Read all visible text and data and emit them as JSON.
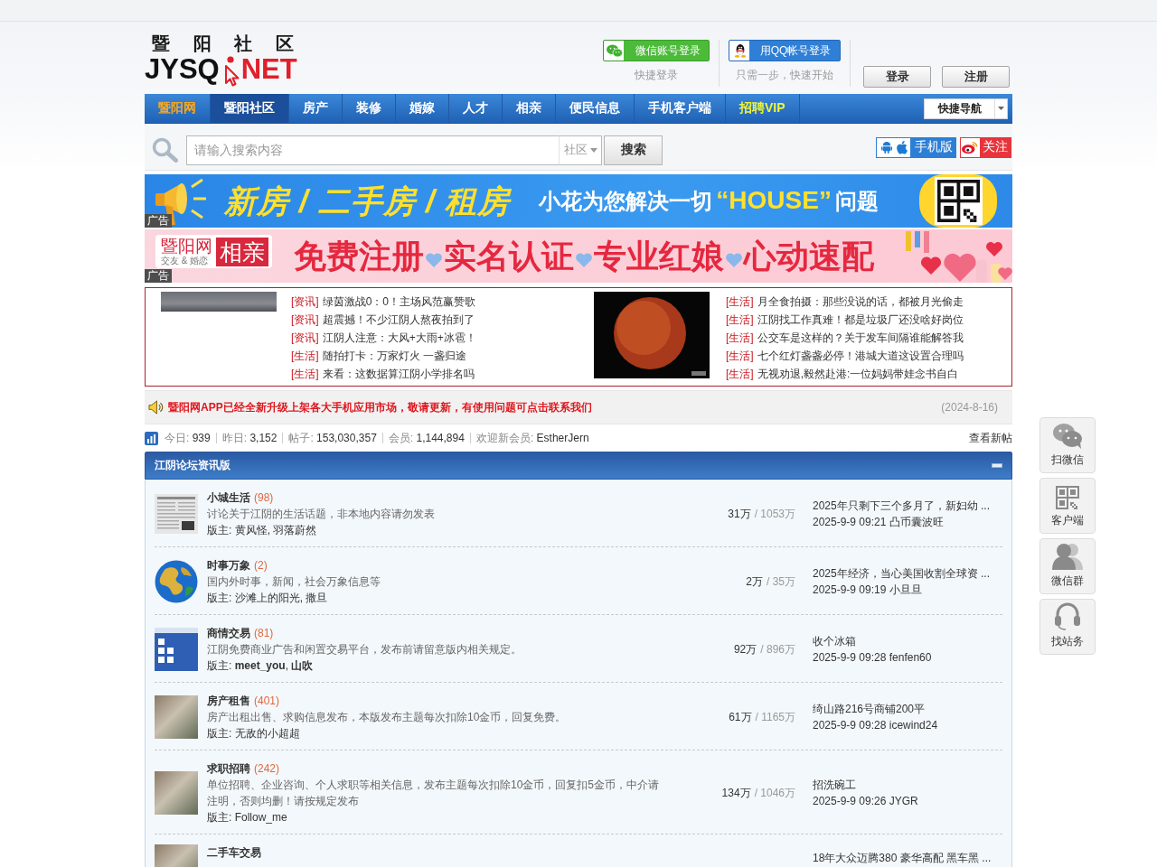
{
  "header": {
    "logo": {
      "title": "暨阳社区",
      "name_left": "JYSQ",
      "name_right": "NET"
    },
    "quick_logins": [
      {
        "kind": "wechat",
        "label": "微信账号登录",
        "caption": "快捷登录"
      },
      {
        "kind": "qq",
        "label": "用QQ帐号登录",
        "caption": "只需一步，快速开始"
      }
    ],
    "buttons": [
      "登录",
      "注册"
    ]
  },
  "nav": {
    "items": [
      {
        "label": "暨阳网",
        "kind": "brand",
        "selected": false
      },
      {
        "label": "暨阳社区",
        "kind": "normal",
        "selected": true
      },
      {
        "label": "房产",
        "kind": "normal",
        "selected": false
      },
      {
        "label": "装修",
        "kind": "normal",
        "selected": false
      },
      {
        "label": "婚嫁",
        "kind": "normal",
        "selected": false
      },
      {
        "label": "人才",
        "kind": "normal",
        "selected": false
      },
      {
        "label": "相亲",
        "kind": "normal",
        "selected": false
      },
      {
        "label": "便民信息",
        "kind": "normal",
        "selected": false
      },
      {
        "label": "手机客户端",
        "kind": "normal",
        "selected": false
      },
      {
        "label": "招聘VIP",
        "kind": "promo",
        "selected": false
      }
    ],
    "quick_nav": "快捷导航"
  },
  "search": {
    "placeholder": "请输入搜索内容",
    "scope": "社区",
    "button": "搜索",
    "mobile_link": "手机版",
    "follow_link": "关注"
  },
  "ads": [
    {
      "kind": "house",
      "badge": "广告",
      "headline": "新房 / 二手房 / 租房",
      "slogan": [
        "小花为您解决一切",
        "“HOUSE”",
        "问题"
      ]
    },
    {
      "kind": "dating",
      "badge": "广告",
      "brand": "暨阳网",
      "brand_tag": "相亲",
      "brand_sub": "交友 & 婚恋",
      "phrases": [
        "免费注册",
        "实名认证",
        "专业红娘",
        "心动速配"
      ]
    }
  ],
  "news": {
    "columns": [
      {
        "kind": "strip",
        "items": [
          {
            "tag": "[资讯]",
            "title": "绿茵激战0：0！主场风范赢赞歌"
          },
          {
            "tag": "[资讯]",
            "title": "超震撼！不少江阴人熬夜拍到了"
          },
          {
            "tag": "[资讯]",
            "title": "江阴人注意：大风+大雨+冰雹！"
          },
          {
            "tag": "[生活]",
            "title": "随拍打卡：万家灯火 一盏归途"
          },
          {
            "tag": "[生活]",
            "title": "来看：这数据算江阴小学排名吗"
          }
        ]
      },
      {
        "kind": "moon",
        "items": [
          {
            "tag": "[生活]",
            "title": "月全食拍摄：那些没说的话，都被月光偷走"
          },
          {
            "tag": "[生活]",
            "title": "江阴找工作真难！都是垃圾厂还没啥好岗位"
          },
          {
            "tag": "[生活]",
            "title": "公交车是这样的？关于发车间隔谁能解答我"
          },
          {
            "tag": "[生活]",
            "title": "七个红灯盏盏必停！港城大道这设置合理吗"
          },
          {
            "tag": "[生活]",
            "title": "无视劝退,毅然赴港:一位妈妈带娃念书自白"
          }
        ]
      }
    ]
  },
  "notice": {
    "text": "暨阳网APP已经全新升级上架各大手机应用市场，敬请更新，有使用问题可点击联系我们",
    "date": "(2024-8-16)"
  },
  "stats": {
    "items": [
      {
        "label": "今日:",
        "value": "939"
      },
      {
        "label": "昨日:",
        "value": "3,152"
      },
      {
        "label": "帖子:",
        "value": "153,030,357"
      },
      {
        "label": "会员:",
        "value": "1,144,894"
      },
      {
        "label": "欢迎新会员:",
        "value": "EstherJern"
      }
    ],
    "link": "查看新帖"
  },
  "forum": {
    "title": "江阴论坛资讯版",
    "boards": [
      {
        "kind": "newspaper",
        "name": "小城生活",
        "count": "(98)",
        "description": "讨论关于江阴的生活话题，非本地内容请勿发表",
        "moderators": "版主: 黄风怪, 羽落蔚然",
        "threads": "31万",
        "posts": "/ 1053万",
        "last_title": "2025年只剩下三个多月了，新妇幼 ...",
        "last_meta": "2025-9-9 09:21 凸币囊波旺"
      },
      {
        "kind": "globe",
        "name": "时事万象",
        "count": "(2)",
        "description": "国内外时事，新闻，社会万象信息等",
        "moderators": "版主: 沙滩上的阳光, 撒旦",
        "threads": "2万",
        "posts": "/ 35万",
        "last_title": "2025年经济，当心美国收割全球资 ...",
        "last_meta": "2025-9-9 09:19 小旦旦"
      },
      {
        "kind": "window",
        "name": "商情交易",
        "count": "(81)",
        "description": "江阴免费商业广告和闲置交易平台，发布前请留意版内相关规定。",
        "moderators": "版主: **meet_you**, **山吹**",
        "threads": "92万",
        "posts": "/ 896万",
        "last_title": "收个冰箱",
        "last_meta": "2025-9-9 09:28 fenfen60"
      },
      {
        "kind": "photo",
        "name": "房产租售",
        "count": "(401)",
        "description": "房产出租出售、求购信息发布，本版发布主题每次扣除10金币，回复免费。",
        "moderators": "版主: 无敌的小超超",
        "threads": "61万",
        "posts": "/ 1165万",
        "last_title": "绮山路216号商铺200平",
        "last_meta": "2025-9-9 09:28 icewind24"
      },
      {
        "kind": "photo",
        "name": "求职招聘",
        "count": "(242)",
        "description": "单位招聘、企业咨询、个人求职等相关信息，发布主题每次扣除10金币，回复扣5金币，中介请注明，否则均删！请按规定发布",
        "moderators": "版主: Follow_me",
        "threads": "134万",
        "posts": "/ 1046万",
        "last_title": "招洗碗工",
        "last_meta": "2025-9-9 09:26 JYGR"
      },
      {
        "kind": "photo",
        "name": "二手车交易",
        "last_title": "18年大众迈腾380 豪华高配 黑车黑 ..."
      }
    ]
  },
  "float_toolbar": [
    {
      "kind": "wechat",
      "label": "扫微信"
    },
    {
      "kind": "qrcode",
      "label": "客户端"
    },
    {
      "kind": "group",
      "label": "微信群"
    },
    {
      "kind": "headset",
      "label": "找站务"
    }
  ]
}
